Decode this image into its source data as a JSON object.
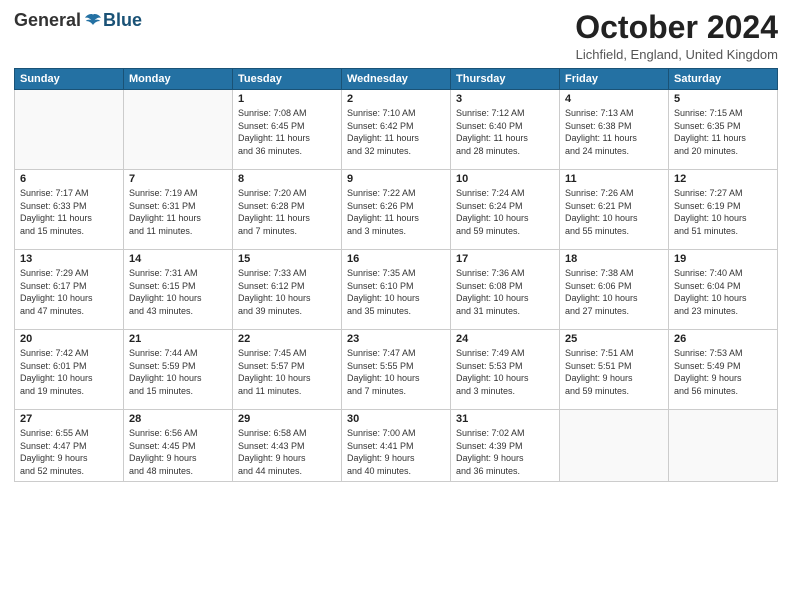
{
  "logo": {
    "general": "General",
    "blue": "Blue"
  },
  "title": "October 2024",
  "location": "Lichfield, England, United Kingdom",
  "days_header": [
    "Sunday",
    "Monday",
    "Tuesday",
    "Wednesday",
    "Thursday",
    "Friday",
    "Saturday"
  ],
  "weeks": [
    [
      {
        "day": "",
        "info": ""
      },
      {
        "day": "",
        "info": ""
      },
      {
        "day": "1",
        "info": "Sunrise: 7:08 AM\nSunset: 6:45 PM\nDaylight: 11 hours\nand 36 minutes."
      },
      {
        "day": "2",
        "info": "Sunrise: 7:10 AM\nSunset: 6:42 PM\nDaylight: 11 hours\nand 32 minutes."
      },
      {
        "day": "3",
        "info": "Sunrise: 7:12 AM\nSunset: 6:40 PM\nDaylight: 11 hours\nand 28 minutes."
      },
      {
        "day": "4",
        "info": "Sunrise: 7:13 AM\nSunset: 6:38 PM\nDaylight: 11 hours\nand 24 minutes."
      },
      {
        "day": "5",
        "info": "Sunrise: 7:15 AM\nSunset: 6:35 PM\nDaylight: 11 hours\nand 20 minutes."
      }
    ],
    [
      {
        "day": "6",
        "info": "Sunrise: 7:17 AM\nSunset: 6:33 PM\nDaylight: 11 hours\nand 15 minutes."
      },
      {
        "day": "7",
        "info": "Sunrise: 7:19 AM\nSunset: 6:31 PM\nDaylight: 11 hours\nand 11 minutes."
      },
      {
        "day": "8",
        "info": "Sunrise: 7:20 AM\nSunset: 6:28 PM\nDaylight: 11 hours\nand 7 minutes."
      },
      {
        "day": "9",
        "info": "Sunrise: 7:22 AM\nSunset: 6:26 PM\nDaylight: 11 hours\nand 3 minutes."
      },
      {
        "day": "10",
        "info": "Sunrise: 7:24 AM\nSunset: 6:24 PM\nDaylight: 10 hours\nand 59 minutes."
      },
      {
        "day": "11",
        "info": "Sunrise: 7:26 AM\nSunset: 6:21 PM\nDaylight: 10 hours\nand 55 minutes."
      },
      {
        "day": "12",
        "info": "Sunrise: 7:27 AM\nSunset: 6:19 PM\nDaylight: 10 hours\nand 51 minutes."
      }
    ],
    [
      {
        "day": "13",
        "info": "Sunrise: 7:29 AM\nSunset: 6:17 PM\nDaylight: 10 hours\nand 47 minutes."
      },
      {
        "day": "14",
        "info": "Sunrise: 7:31 AM\nSunset: 6:15 PM\nDaylight: 10 hours\nand 43 minutes."
      },
      {
        "day": "15",
        "info": "Sunrise: 7:33 AM\nSunset: 6:12 PM\nDaylight: 10 hours\nand 39 minutes."
      },
      {
        "day": "16",
        "info": "Sunrise: 7:35 AM\nSunset: 6:10 PM\nDaylight: 10 hours\nand 35 minutes."
      },
      {
        "day": "17",
        "info": "Sunrise: 7:36 AM\nSunset: 6:08 PM\nDaylight: 10 hours\nand 31 minutes."
      },
      {
        "day": "18",
        "info": "Sunrise: 7:38 AM\nSunset: 6:06 PM\nDaylight: 10 hours\nand 27 minutes."
      },
      {
        "day": "19",
        "info": "Sunrise: 7:40 AM\nSunset: 6:04 PM\nDaylight: 10 hours\nand 23 minutes."
      }
    ],
    [
      {
        "day": "20",
        "info": "Sunrise: 7:42 AM\nSunset: 6:01 PM\nDaylight: 10 hours\nand 19 minutes."
      },
      {
        "day": "21",
        "info": "Sunrise: 7:44 AM\nSunset: 5:59 PM\nDaylight: 10 hours\nand 15 minutes."
      },
      {
        "day": "22",
        "info": "Sunrise: 7:45 AM\nSunset: 5:57 PM\nDaylight: 10 hours\nand 11 minutes."
      },
      {
        "day": "23",
        "info": "Sunrise: 7:47 AM\nSunset: 5:55 PM\nDaylight: 10 hours\nand 7 minutes."
      },
      {
        "day": "24",
        "info": "Sunrise: 7:49 AM\nSunset: 5:53 PM\nDaylight: 10 hours\nand 3 minutes."
      },
      {
        "day": "25",
        "info": "Sunrise: 7:51 AM\nSunset: 5:51 PM\nDaylight: 9 hours\nand 59 minutes."
      },
      {
        "day": "26",
        "info": "Sunrise: 7:53 AM\nSunset: 5:49 PM\nDaylight: 9 hours\nand 56 minutes."
      }
    ],
    [
      {
        "day": "27",
        "info": "Sunrise: 6:55 AM\nSunset: 4:47 PM\nDaylight: 9 hours\nand 52 minutes."
      },
      {
        "day": "28",
        "info": "Sunrise: 6:56 AM\nSunset: 4:45 PM\nDaylight: 9 hours\nand 48 minutes."
      },
      {
        "day": "29",
        "info": "Sunrise: 6:58 AM\nSunset: 4:43 PM\nDaylight: 9 hours\nand 44 minutes."
      },
      {
        "day": "30",
        "info": "Sunrise: 7:00 AM\nSunset: 4:41 PM\nDaylight: 9 hours\nand 40 minutes."
      },
      {
        "day": "31",
        "info": "Sunrise: 7:02 AM\nSunset: 4:39 PM\nDaylight: 9 hours\nand 36 minutes."
      },
      {
        "day": "",
        "info": ""
      },
      {
        "day": "",
        "info": ""
      }
    ]
  ]
}
